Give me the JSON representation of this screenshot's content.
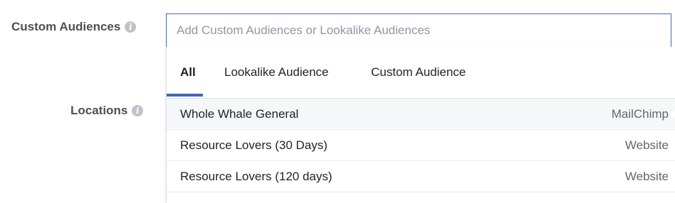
{
  "form": {
    "custom_audiences_label": "Custom Audiences",
    "locations_label": "Locations",
    "info_glyph": "i"
  },
  "search": {
    "placeholder": "Add Custom Audiences or Lookalike Audiences",
    "value": ""
  },
  "tabs": [
    {
      "label": "All",
      "active": true
    },
    {
      "label": "Lookalike Audience",
      "active": false
    },
    {
      "label": "Custom Audience",
      "active": false
    }
  ],
  "audiences": [
    {
      "name": "Whole Whale General",
      "source": "MailChimp"
    },
    {
      "name": "Resource Lovers (30 Days)",
      "source": "Website"
    },
    {
      "name": "Resource Lovers (120 days)",
      "source": "Website"
    }
  ],
  "colors": {
    "accent": "#4267b2",
    "label_text": "#4b4f56",
    "info_icon": "#bec3c9",
    "hover_row": "#f6f7f9"
  },
  "icons": {
    "info": "info-icon"
  }
}
